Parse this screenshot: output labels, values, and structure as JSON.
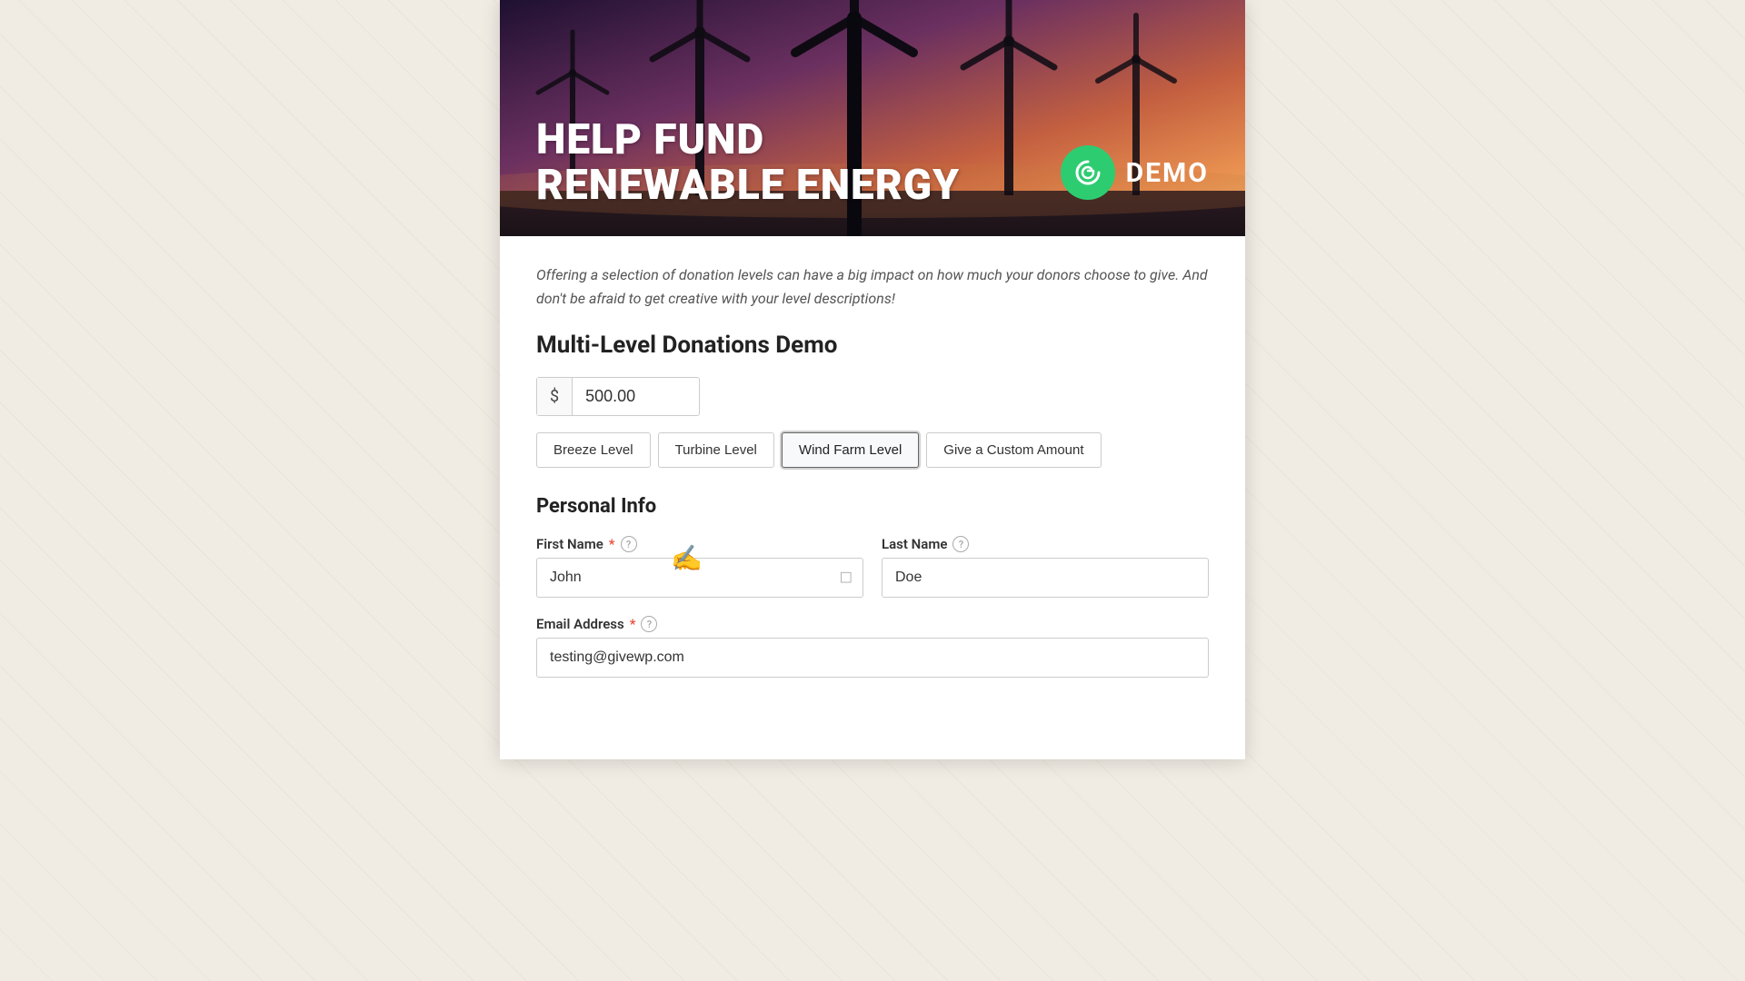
{
  "hero": {
    "title_line1": "HELP FUND",
    "title_line2": "RENEWABLE ENERGY",
    "demo_label": "DEMO"
  },
  "description": "Offering a selection of donation levels can have a big impact on how much your donors choose to give. And don't be afraid to get creative with your level descriptions!",
  "form_title": "Multi-Level Donations Demo",
  "amount": {
    "currency": "$",
    "value": "500.00"
  },
  "donation_levels": [
    {
      "id": "breeze",
      "label": "Breeze Level",
      "active": false
    },
    {
      "id": "turbine",
      "label": "Turbine Level",
      "active": false
    },
    {
      "id": "wind-farm",
      "label": "Wind Farm Level",
      "active": true
    },
    {
      "id": "custom",
      "label": "Give a Custom Amount",
      "active": false
    }
  ],
  "personal_info": {
    "title": "Personal Info",
    "first_name": {
      "label": "First Name",
      "required": true,
      "value": "John",
      "placeholder": "John"
    },
    "last_name": {
      "label": "Last Name",
      "required": false,
      "value": "Doe",
      "placeholder": "Doe"
    },
    "email": {
      "label": "Email Address",
      "required": true,
      "value": "testing@givewp.com",
      "placeholder": "testing@givewp.com"
    }
  }
}
